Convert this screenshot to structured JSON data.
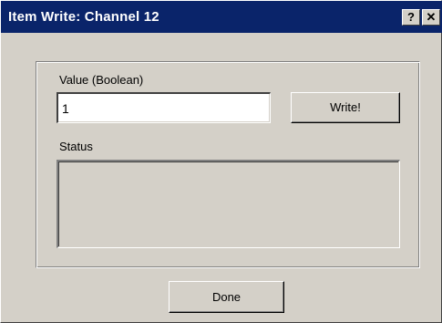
{
  "window": {
    "title": "Item Write: Channel 12",
    "help_button": "?",
    "close_button": "✕"
  },
  "form": {
    "value_label": "Value (Boolean)",
    "value": "1",
    "write_button": "Write!",
    "status_label": "Status",
    "status_text": ""
  },
  "footer": {
    "done_button": "Done"
  },
  "colors": {
    "titlebar": "#0a246a",
    "dialog_face": "#d4d0c8",
    "input_bg": "#ffffff"
  }
}
